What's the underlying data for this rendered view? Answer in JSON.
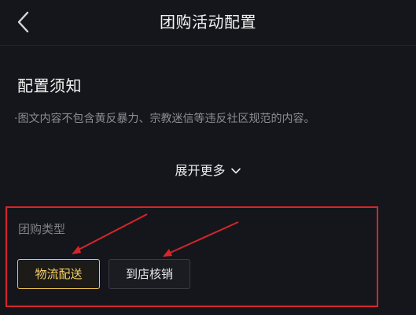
{
  "header": {
    "back_icon": "chevron-left-icon",
    "title": "团购活动配置"
  },
  "notice": {
    "title": "配置须知",
    "text": "·图文内容不包含黄反暴力、宗教迷信等违反社区规范的内容。",
    "expand_label": "展开更多",
    "expand_icon": "chevron-down-icon"
  },
  "group_buy_type": {
    "label": "团购类型",
    "options": [
      {
        "label": "物流配送",
        "selected": true
      },
      {
        "label": "到店核销",
        "selected": false
      }
    ]
  },
  "colors": {
    "background": "#15161b",
    "selected_accent": "#f6cf63",
    "annotation_red": "#d4262b"
  }
}
